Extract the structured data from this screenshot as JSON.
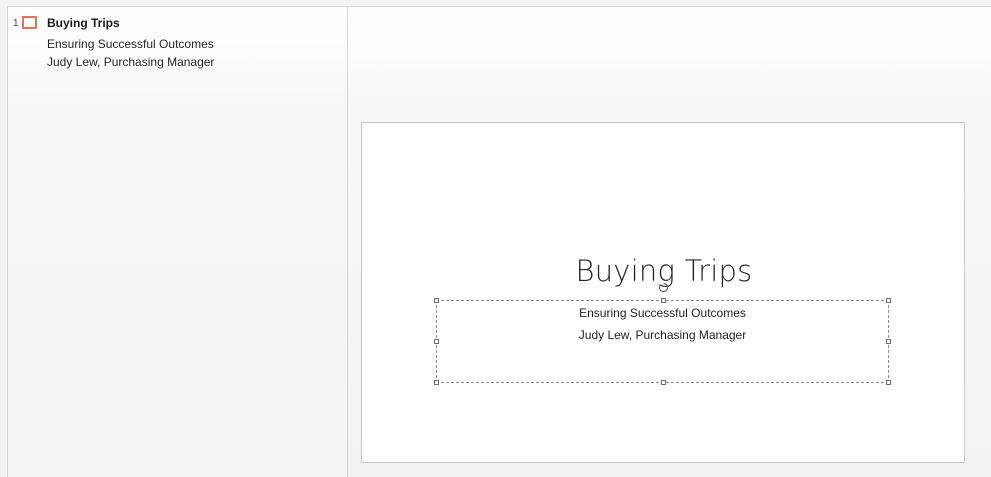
{
  "outline": {
    "slide_number": "1",
    "title": "Buying Trips",
    "lines": [
      "Ensuring Successful Outcomes",
      "Judy Lew, Purchasing Manager"
    ]
  },
  "slide": {
    "title": "Buying Trips",
    "subtitle_lines": [
      "Ensuring Successful Outcomes",
      "Judy Lew, Purchasing Manager"
    ]
  },
  "colors": {
    "slide_icon_accent": "#e8715a",
    "selection_border": "#8a8a8a"
  },
  "icons": {
    "slide_icon": "slide-icon",
    "rotate_handle": "rotate-handle-icon"
  }
}
